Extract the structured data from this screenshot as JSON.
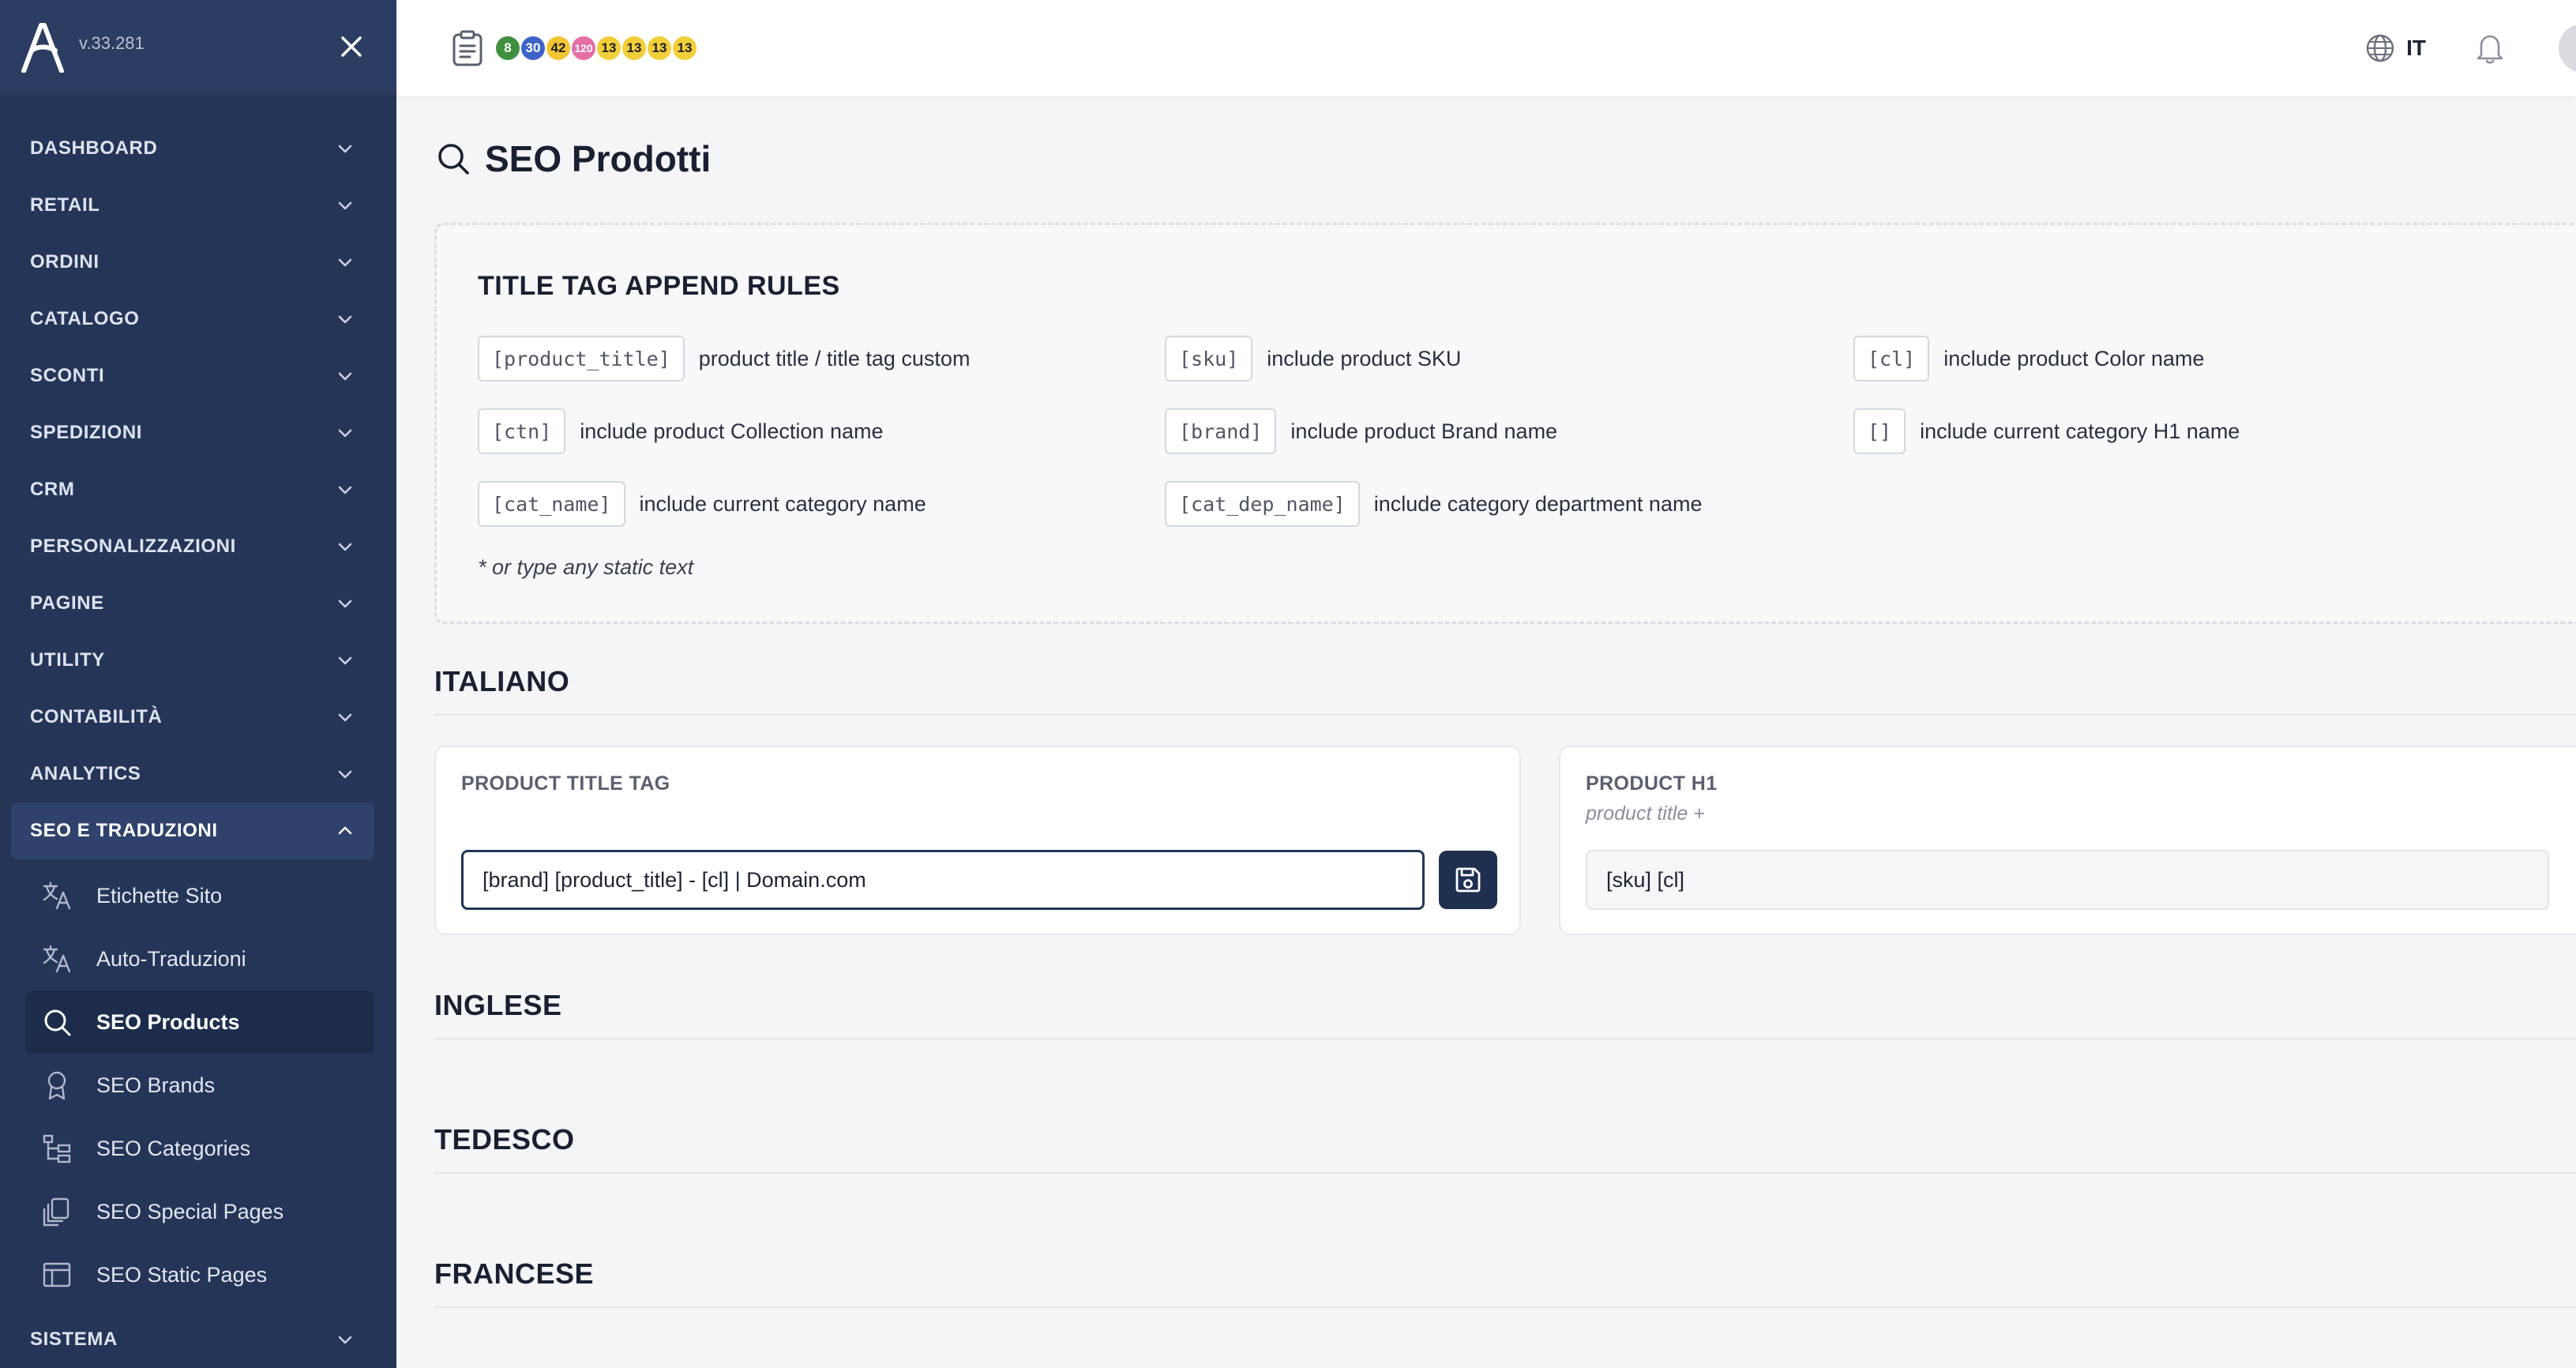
{
  "app": {
    "version": "v.33.281"
  },
  "sidebar": {
    "menu": [
      {
        "label": "DASHBOARD"
      },
      {
        "label": "RETAIL"
      },
      {
        "label": "ORDINI"
      },
      {
        "label": "CATALOGO"
      },
      {
        "label": "SCONTI"
      },
      {
        "label": "SPEDIZIONI"
      },
      {
        "label": "CRM"
      },
      {
        "label": "PERSONALIZZAZIONI"
      },
      {
        "label": "PAGINE"
      },
      {
        "label": "UTILITY"
      },
      {
        "label": "CONTABILITÀ"
      },
      {
        "label": "ANALYTICS"
      }
    ],
    "open_section": {
      "label": "SEO E TRADUZIONI",
      "items": [
        {
          "label": "Etichette Sito",
          "icon": "translate-icon"
        },
        {
          "label": "Auto-Traduzioni",
          "icon": "translate-icon"
        },
        {
          "label": "SEO Products",
          "icon": "search-icon",
          "active": true
        },
        {
          "label": "SEO Brands",
          "icon": "award-icon"
        },
        {
          "label": "SEO Categories",
          "icon": "hierarchy-icon"
        },
        {
          "label": "SEO Special Pages",
          "icon": "copy-icon"
        },
        {
          "label": "SEO Static Pages",
          "icon": "layout-icon"
        }
      ]
    },
    "bottom_item": {
      "label": "SISTEMA"
    }
  },
  "topbar": {
    "badges": [
      {
        "value": "8",
        "color": "#3f8f3f"
      },
      {
        "value": "30",
        "color": "#3d63c9"
      },
      {
        "value": "42",
        "color": "#f2c531"
      },
      {
        "value": "120",
        "color": "#e46fa6"
      },
      {
        "value": "13",
        "color": "#f2cf3a"
      },
      {
        "value": "13",
        "color": "#f2cf3a"
      },
      {
        "value": "13",
        "color": "#f2cf3a"
      },
      {
        "value": "13",
        "color": "#f2cf3a"
      }
    ],
    "language": "IT"
  },
  "page": {
    "title": "SEO Prodotti"
  },
  "rules": {
    "title": "TITLE TAG APPEND RULES",
    "items": [
      {
        "code": "[product_title]",
        "desc": "product title / title tag custom"
      },
      {
        "code": "[sku]",
        "desc": "include product SKU"
      },
      {
        "code": "[cl]",
        "desc": "include product Color name"
      },
      {
        "code": "[ctn]",
        "desc": "include product Collection name"
      },
      {
        "code": "[brand]",
        "desc": "include product Brand name"
      },
      {
        "code": "[]",
        "desc": "include current category H1 name"
      },
      {
        "code": "[cat_name]",
        "desc": "include current category name"
      },
      {
        "code": "[cat_dep_name]",
        "desc": "include category department name"
      }
    ],
    "note": "* or type any static text"
  },
  "languages": {
    "italian": {
      "heading": "ITALIANO",
      "title_tag": {
        "label": "PRODUCT TITLE TAG",
        "value": "[brand] [product_title] - [cl] | Domain.com"
      },
      "h1": {
        "label": "PRODUCT H1",
        "sub": "product title +",
        "value": "[sku] [cl]"
      }
    },
    "english": {
      "heading": "INGLESE"
    },
    "german": {
      "heading": "TEDESCO"
    },
    "french": {
      "heading": "FRANCESE"
    }
  }
}
